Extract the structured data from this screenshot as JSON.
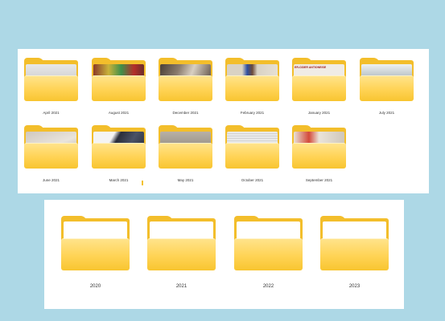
{
  "groups": {
    "months": {
      "folders": [
        {
          "name": "April 2021"
        },
        {
          "name": "August 2021"
        },
        {
          "name": "December 2021"
        },
        {
          "name": "February 2021"
        },
        {
          "name": "January 2021"
        },
        {
          "name": "July 2021"
        },
        {
          "name": "June 2021"
        },
        {
          "name": "March 2021"
        },
        {
          "name": "May 2021"
        },
        {
          "name": "October 2021"
        },
        {
          "name": "September 2021"
        }
      ],
      "thumbnail_text": {
        "january": "ER-CIDER ANTIONEISE"
      }
    },
    "years": {
      "folders": [
        {
          "name": "2020"
        },
        {
          "name": "2021"
        },
        {
          "name": "2022"
        },
        {
          "name": "2023"
        }
      ]
    }
  },
  "colors": {
    "background": "#add8e6",
    "folder_back": "#f3be2b",
    "folder_front": "#ffd354",
    "panel": "#ffffff"
  }
}
